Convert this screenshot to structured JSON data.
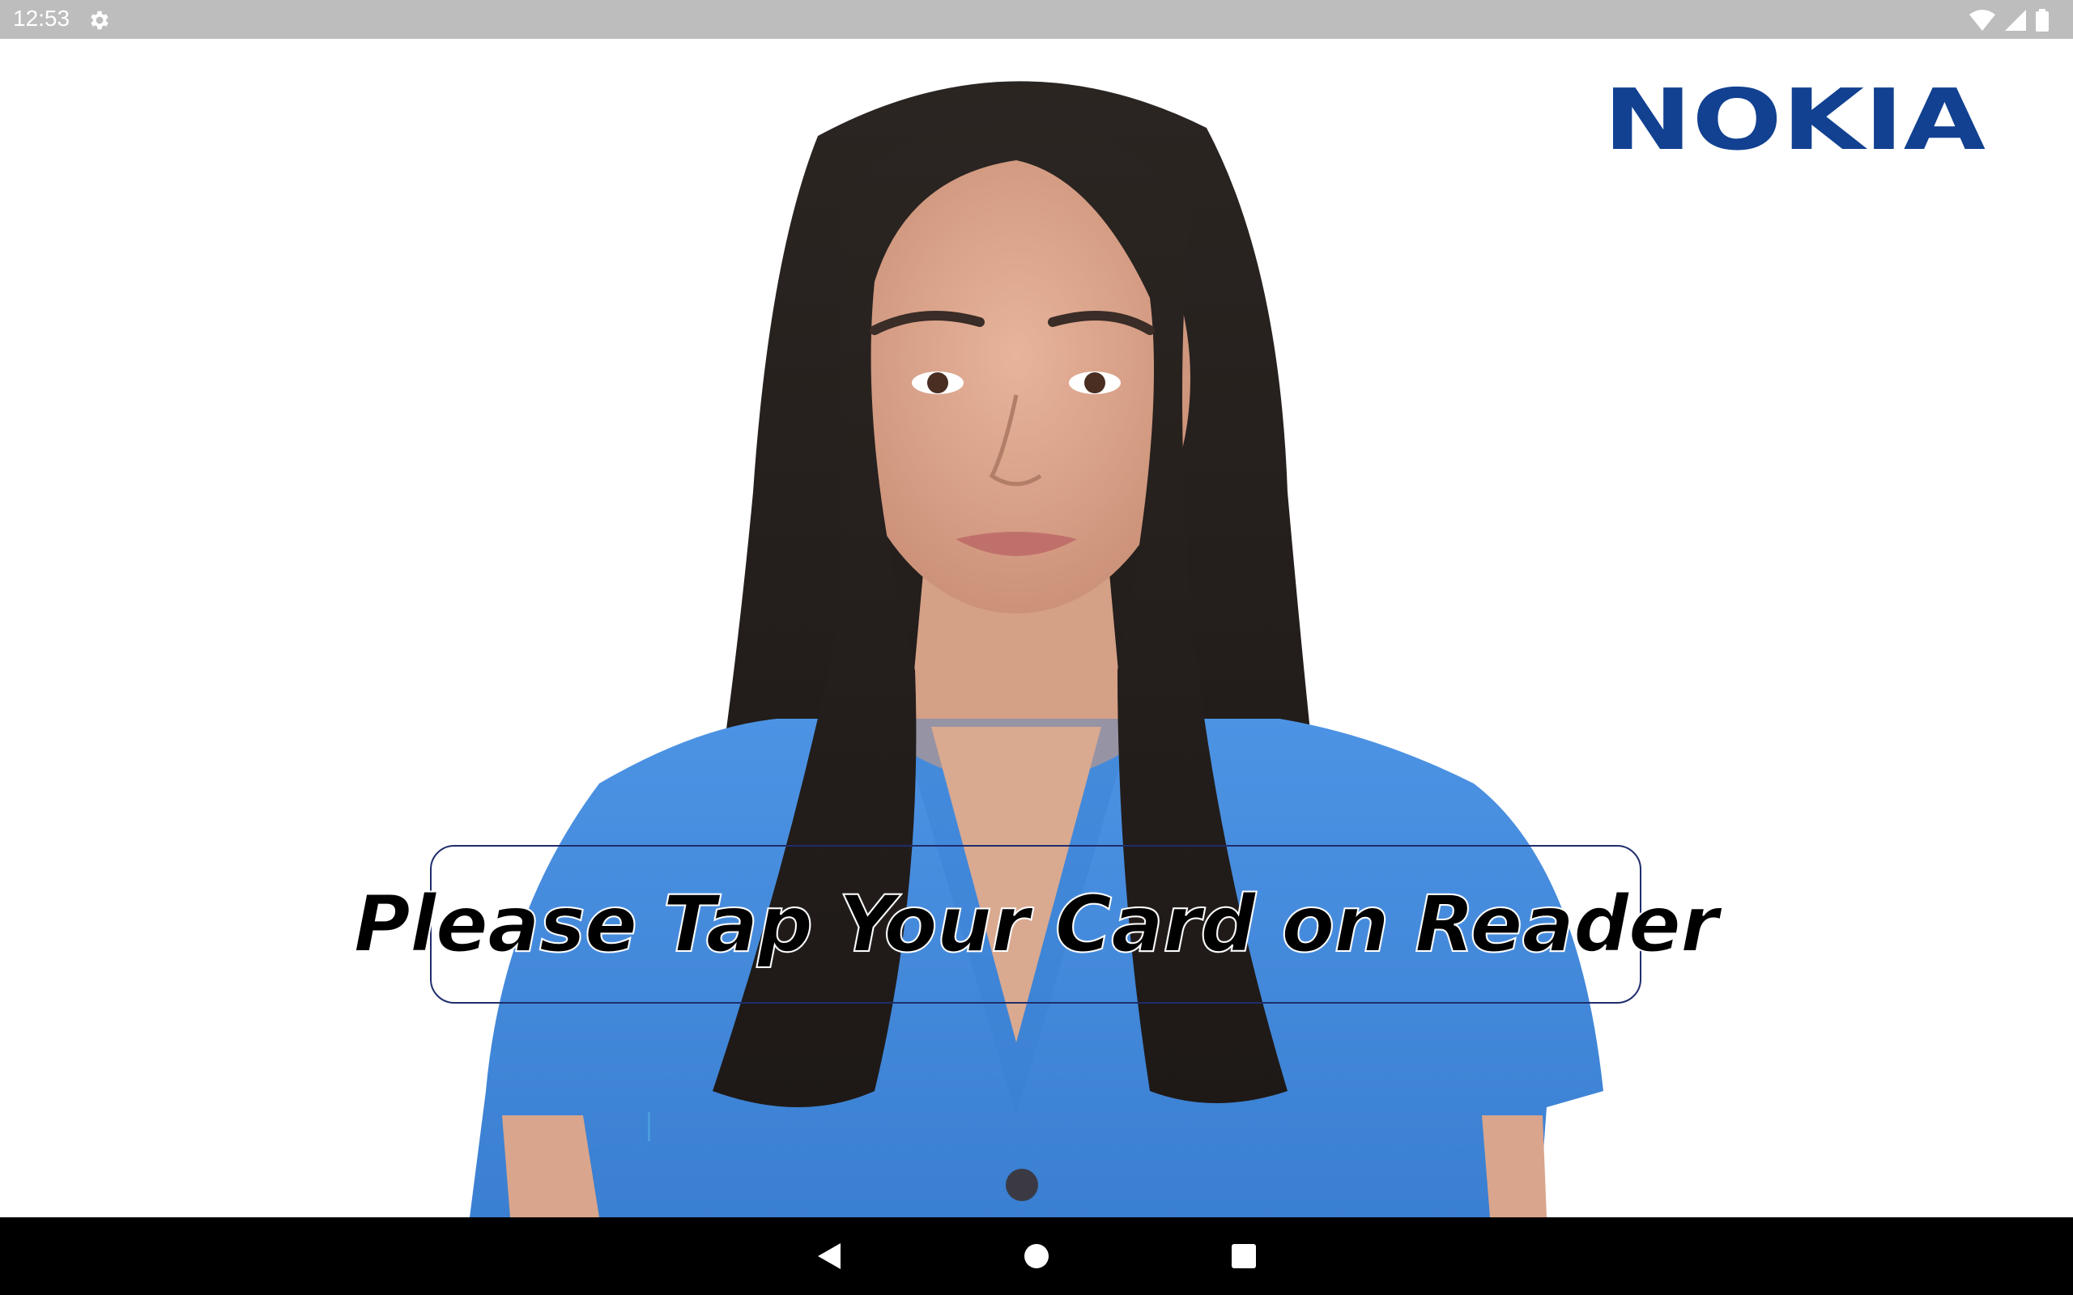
{
  "status_bar": {
    "time": "12:53",
    "icons": [
      "settings-gear-icon",
      "wifi-icon",
      "cell-signal-icon",
      "battery-icon"
    ]
  },
  "branding": {
    "logo_text": "NOKIA",
    "logo_color": "#124191"
  },
  "prompt": {
    "text": "Please Tap Your Card on Reader",
    "border_color": "#1f2d6b"
  },
  "presenter": {
    "shirt_color": "#4a90e2",
    "hair_color": "#2a2422"
  },
  "nav_bar": {
    "buttons": [
      "back-icon",
      "home-icon",
      "recents-icon"
    ]
  }
}
